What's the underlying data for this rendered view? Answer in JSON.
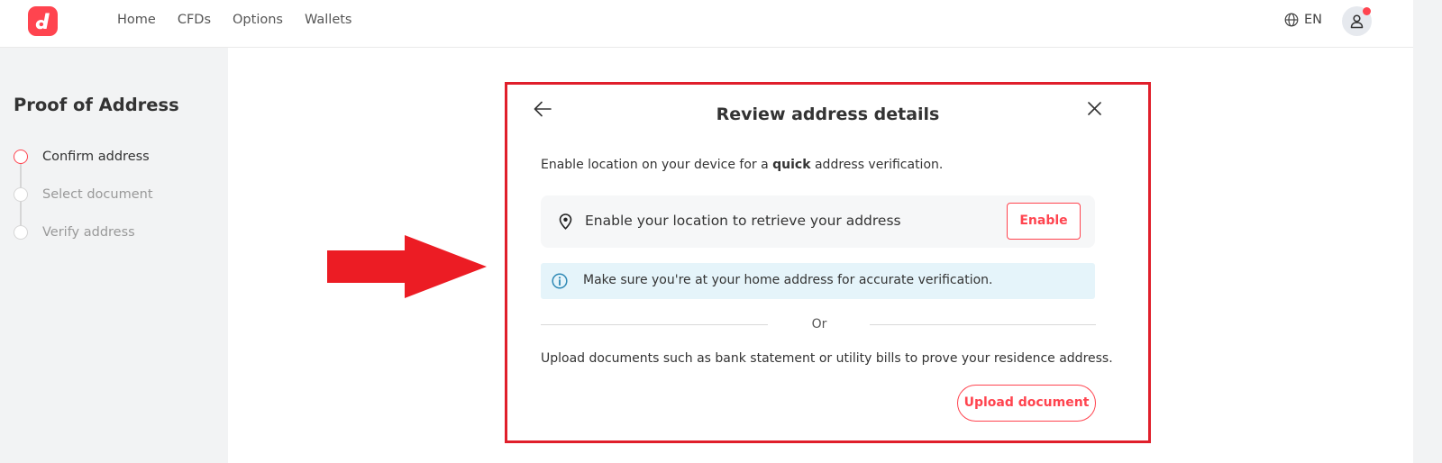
{
  "header": {
    "logo_icon": "deriv-logo-icon",
    "nav": [
      "Home",
      "CFDs",
      "Options",
      "Wallets"
    ],
    "language": "EN",
    "language_icon": "globe-icon",
    "account_icon": "user-icon",
    "notification_color": "#ff444f"
  },
  "sidebar": {
    "title": "Proof of Address",
    "steps": [
      {
        "label": "Confirm address",
        "active": true
      },
      {
        "label": "Select document",
        "active": false
      },
      {
        "label": "Verify address",
        "active": false
      }
    ]
  },
  "dialog": {
    "title": "Review address details",
    "intro_prefix": "Enable location on your device for a ",
    "intro_emphasis": "quick",
    "intro_suffix": " address verification.",
    "location_text": "Enable your location to retrieve your address",
    "enable_label": "Enable",
    "info_text": "Make sure you're at your home address for accurate verification.",
    "separator_label": "Or",
    "upload_text": "Upload documents such as bank statement or utility bills to prove your residence address.",
    "upload_label": "Upload document"
  },
  "colors": {
    "brand": "#ff444f",
    "highlight_frame": "#e01f2b",
    "info_background": "#e5f4fa",
    "sidebar_background": "#f2f3f4"
  }
}
